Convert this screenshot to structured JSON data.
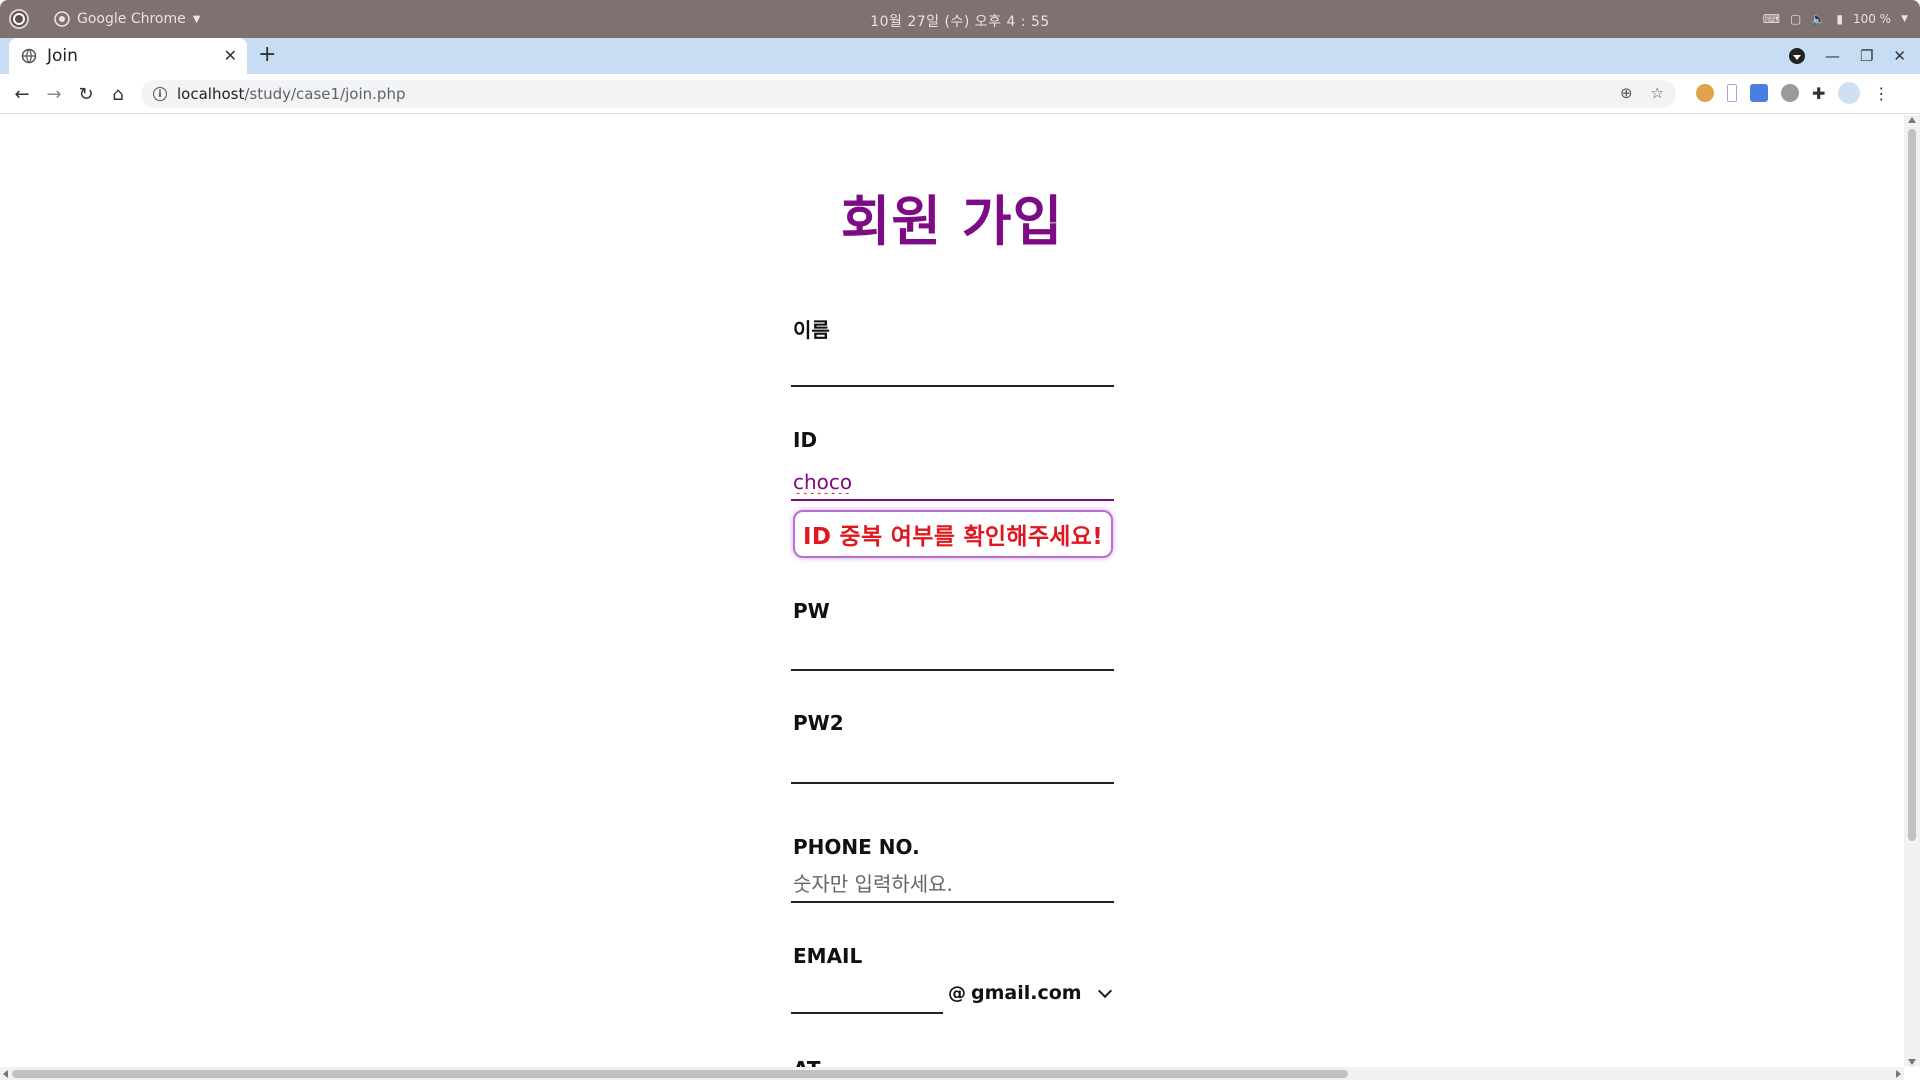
{
  "os": {
    "app_name": "Google Chrome",
    "clock": "10월 27일 (수) 오후 4 : 55",
    "battery": "100 %"
  },
  "browser": {
    "tab_title": "Join",
    "url_host": "localhost",
    "url_path": "/study/case1/join.php"
  },
  "form": {
    "title": "회원 가입",
    "name_label": "이름",
    "name_value": "",
    "id_label": "ID",
    "id_value": "choco",
    "id_warning": "ID 중복 여부를 확인해주세요!",
    "pw_label": "PW",
    "pw2_label": "PW2",
    "phone_label": "PHONE NO.",
    "phone_placeholder": "숫자만 입력하세요.",
    "email_label": "EMAIL",
    "email_at": "@",
    "email_domain": "gmail.com",
    "next_label_partial": "AT"
  },
  "colors": {
    "title": "#7d0b86",
    "warning_text": "#e0171f",
    "warning_border": "#b96fd0",
    "tabstrip": "#c7ddf3",
    "os_bar": "#7e7170"
  }
}
